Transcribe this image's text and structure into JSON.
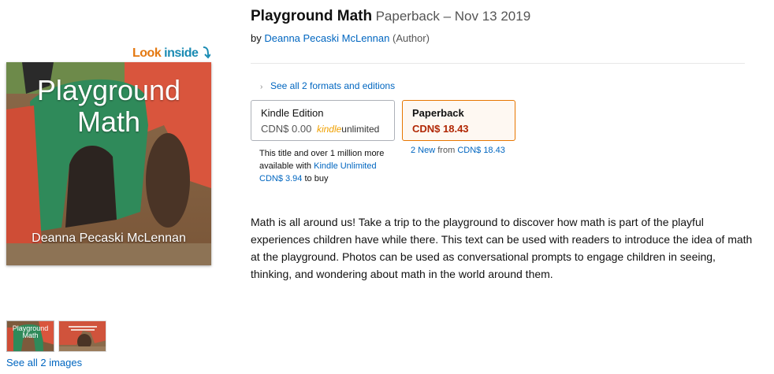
{
  "product": {
    "title": "Playground Math",
    "format_date": "Paperback – Nov 13 2019",
    "by_prefix": "by",
    "author": "Deanna Pecaski McLennan",
    "author_role": "(Author)"
  },
  "look_inside": {
    "look": "Look",
    "inside": "inside"
  },
  "cover": {
    "title_line1": "Playground",
    "title_line2": "Math",
    "author": "Deanna Pecaski McLennan"
  },
  "thumbnails": {
    "thumb1_title": "Playground Math",
    "see_all_label": "See all 2 images"
  },
  "formats": {
    "see_all_label": "See all 2 formats and editions",
    "kindle": {
      "name": "Kindle Edition",
      "price": "CDN$ 0.00",
      "ku_kindle": "kindle",
      "ku_unlimited": "unlimited",
      "note_text": "This title and over 1 million more available with",
      "note_link": "Kindle Unlimited",
      "buy_price": "CDN$ 3.94",
      "buy_suffix": "to buy"
    },
    "paperback": {
      "name": "Paperback",
      "price": "CDN$ 18.43",
      "new_count": "2 New",
      "from_text": "from",
      "from_price": "CDN$ 18.43"
    }
  },
  "description": "Math is all around us! Take a trip to the playground to discover how math is part of the playful experiences children have while there. This text can be used with readers to introduce the idea of math at the playground. Photos can be used as conversational prompts to engage children in seeing, thinking, and wondering about math in the world around them.",
  "colors": {
    "link": "#0066c0",
    "price_red": "#b12704",
    "selected_border": "#e77600",
    "look_orange": "#e47911"
  }
}
